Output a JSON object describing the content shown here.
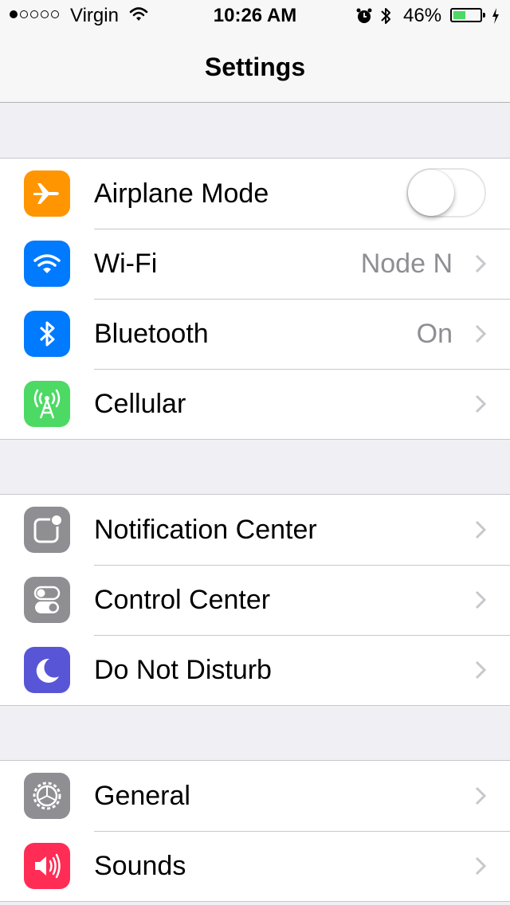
{
  "status_bar": {
    "carrier": "Virgin",
    "time": "10:26 AM",
    "battery_percent": "46%",
    "battery_level": 0.46,
    "signal_dots_filled": 1,
    "signal_dots_total": 5
  },
  "nav": {
    "title": "Settings"
  },
  "groups": [
    {
      "rows": [
        {
          "label": "Airplane Mode",
          "icon": "airplane-icon",
          "color": "#ff9500",
          "toggle": false
        },
        {
          "label": "Wi-Fi",
          "icon": "wifi-icon",
          "color": "#007aff",
          "detail": "Node N"
        },
        {
          "label": "Bluetooth",
          "icon": "bluetooth-icon",
          "color": "#007aff",
          "detail": "On"
        },
        {
          "label": "Cellular",
          "icon": "cellular-antenna-icon",
          "color": "#4cd964",
          "detail": ""
        }
      ]
    },
    {
      "rows": [
        {
          "label": "Notification Center",
          "icon": "notification-center-icon",
          "color": "#8e8e93"
        },
        {
          "label": "Control Center",
          "icon": "control-center-icon",
          "color": "#8e8e93"
        },
        {
          "label": "Do Not Disturb",
          "icon": "moon-icon",
          "color": "#5856d6"
        }
      ]
    },
    {
      "rows": [
        {
          "label": "General",
          "icon": "gear-icon",
          "color": "#8e8e93"
        },
        {
          "label": "Sounds",
          "icon": "speaker-icon",
          "color": "#ff2d55"
        }
      ]
    }
  ]
}
